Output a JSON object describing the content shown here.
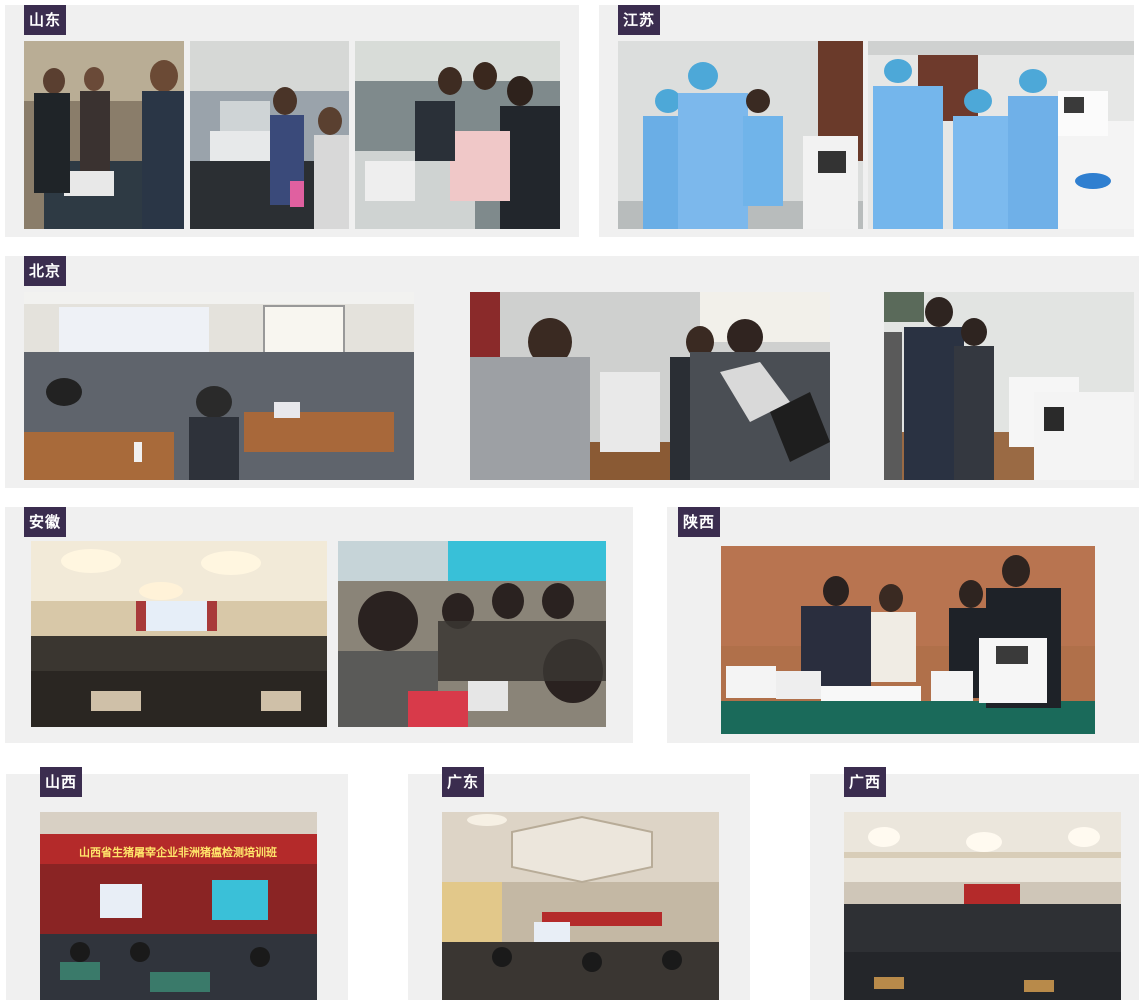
{
  "regions": {
    "shandong": "山东",
    "jiangsu": "江苏",
    "beijing": "北京",
    "anhui": "安徽",
    "shaanxi": "陕西",
    "shanxi": "山西",
    "guangdong": "广东",
    "guangxi": "广西"
  },
  "banner_text": "山西省生猪屠宰企业非洲猪瘟检测培训班",
  "colors": {
    "tag_bg": "#3b2d4f",
    "panel_bg": "#f0f0f0",
    "banner_red": "#c0252b"
  }
}
